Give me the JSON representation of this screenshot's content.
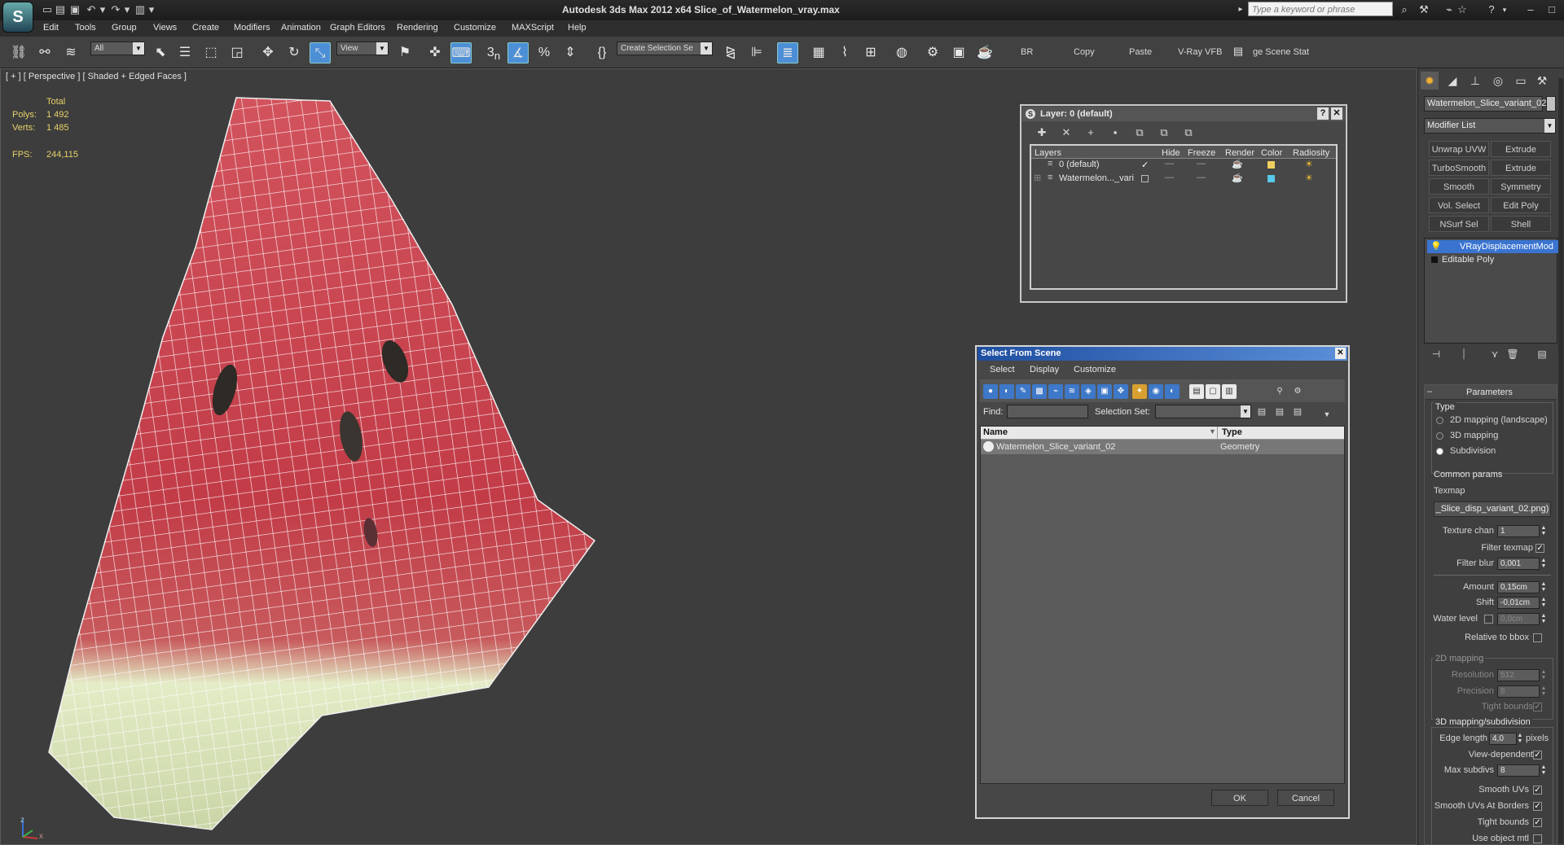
{
  "window": {
    "title": "Autodesk 3ds Max  2012 x64      Slice_of_Watermelon_vray.max",
    "logo": "S"
  },
  "search": {
    "placeholder": "Type a keyword or phrase"
  },
  "menu": [
    "Edit",
    "Tools",
    "Group",
    "Views",
    "Create",
    "Modifiers",
    "Animation",
    "Graph Editors",
    "Rendering",
    "Customize",
    "MAXScript",
    "Help"
  ],
  "toolbar": {
    "filter_dropdown": "All",
    "refcoord_dropdown": "View",
    "snap_3": "3",
    "snap_n": "n",
    "selset_dropdown": "Create Selection Se",
    "br_label": "BR",
    "copy_label": "Copy",
    "paste_label": "Paste",
    "vfb_label": "V-Ray VFB",
    "scene_states_label": "ge Scene Stat"
  },
  "viewport": {
    "label": "[ + ] [ Perspective ] [ Shaded + Edged Faces ]",
    "stats": {
      "total_label": "Total",
      "polys_label": "Polys:",
      "polys": "1 492",
      "verts_label": "Verts:",
      "verts": "1 485",
      "fps_label": "FPS:",
      "fps": "244,115"
    },
    "axis_z": "z",
    "axis_x": "x"
  },
  "layer_dialog": {
    "title": "Layer: 0 (default)",
    "help": "?",
    "close": "✕",
    "columns": [
      "Layers",
      "Hide",
      "Freeze",
      "Render",
      "Color",
      "Radiosity"
    ],
    "rows": [
      {
        "name": "0 (default)",
        "active": "✓",
        "hide": "—",
        "freeze": "—",
        "color": "#f0d060"
      },
      {
        "name": "Watermelon..._vari",
        "active": "",
        "hide": "—",
        "freeze": "—",
        "color": "#56c8e8"
      }
    ]
  },
  "select_dialog": {
    "title": "Select From Scene",
    "close": "✕",
    "menu": [
      "Select",
      "Display",
      "Customize"
    ],
    "find_label": "Find:",
    "selset_label": "Selection Set:",
    "col_name": "Name",
    "col_type": "Type",
    "items": [
      {
        "name": "Watermelon_Slice_variant_02",
        "type": "Geometry"
      }
    ],
    "ok": "OK",
    "cancel": "Cancel"
  },
  "command_panel": {
    "object_name": "Watermelon_Slice_variant_02",
    "modifier_list": "Modifier List",
    "mod_buttons": [
      "Unwrap UVW",
      "Extrude",
      "TurboSmooth",
      "Extrude",
      "Smooth",
      "Symmetry",
      "Vol. Select",
      "Edit Poly",
      "NSurf Sel",
      "Shell"
    ],
    "stack": [
      "VRayDisplacementMod",
      "Editable Poly"
    ],
    "rollout_title": "Parameters",
    "type_label": "Type",
    "types": [
      "2D mapping (landscape)",
      "3D mapping",
      "Subdivision"
    ],
    "selected_type": 2,
    "common_label": "Common params",
    "texmap_label": "Texmap",
    "texmap_value": "_Slice_disp_variant_02.png)",
    "params": [
      {
        "label": "Texture chan",
        "value": "1"
      },
      {
        "label": "Filter blur",
        "value": "0,001"
      },
      {
        "label": "Amount",
        "value": "0,15cm"
      },
      {
        "label": "Shift",
        "value": "-0,01cm"
      },
      {
        "label": "Water level",
        "value": "0,0cm"
      }
    ],
    "filter_texmap_label": "Filter texmap",
    "relative_bbox_label": "Relative to bbox",
    "map2d_label": "2D mapping",
    "resolution_label": "Resolution",
    "resolution": "512",
    "precision_label": "Precision",
    "precision": "8",
    "tight_bounds_label": "Tight bounds",
    "map3d_label": "3D mapping/subdivision",
    "edge_length_label": "Edge length",
    "edge_length": "4,0",
    "pixels_label": "pixels",
    "view_dependent_label": "View-dependent",
    "max_subdivs_label": "Max subdivs",
    "max_subdivs": "8",
    "smooth_uvs_label": "Smooth UVs",
    "smooth_uvs_borders_label": "Smooth UVs At Borders",
    "tight_bounds2_label": "Tight bounds",
    "use_object_mtl_label": "Use object mtl"
  },
  "colors": {
    "flesh": "#c9464f",
    "rind": "#e4ecc4",
    "selection_blue": "#2f63c6",
    "stat_yellow": "#e6d26a"
  }
}
